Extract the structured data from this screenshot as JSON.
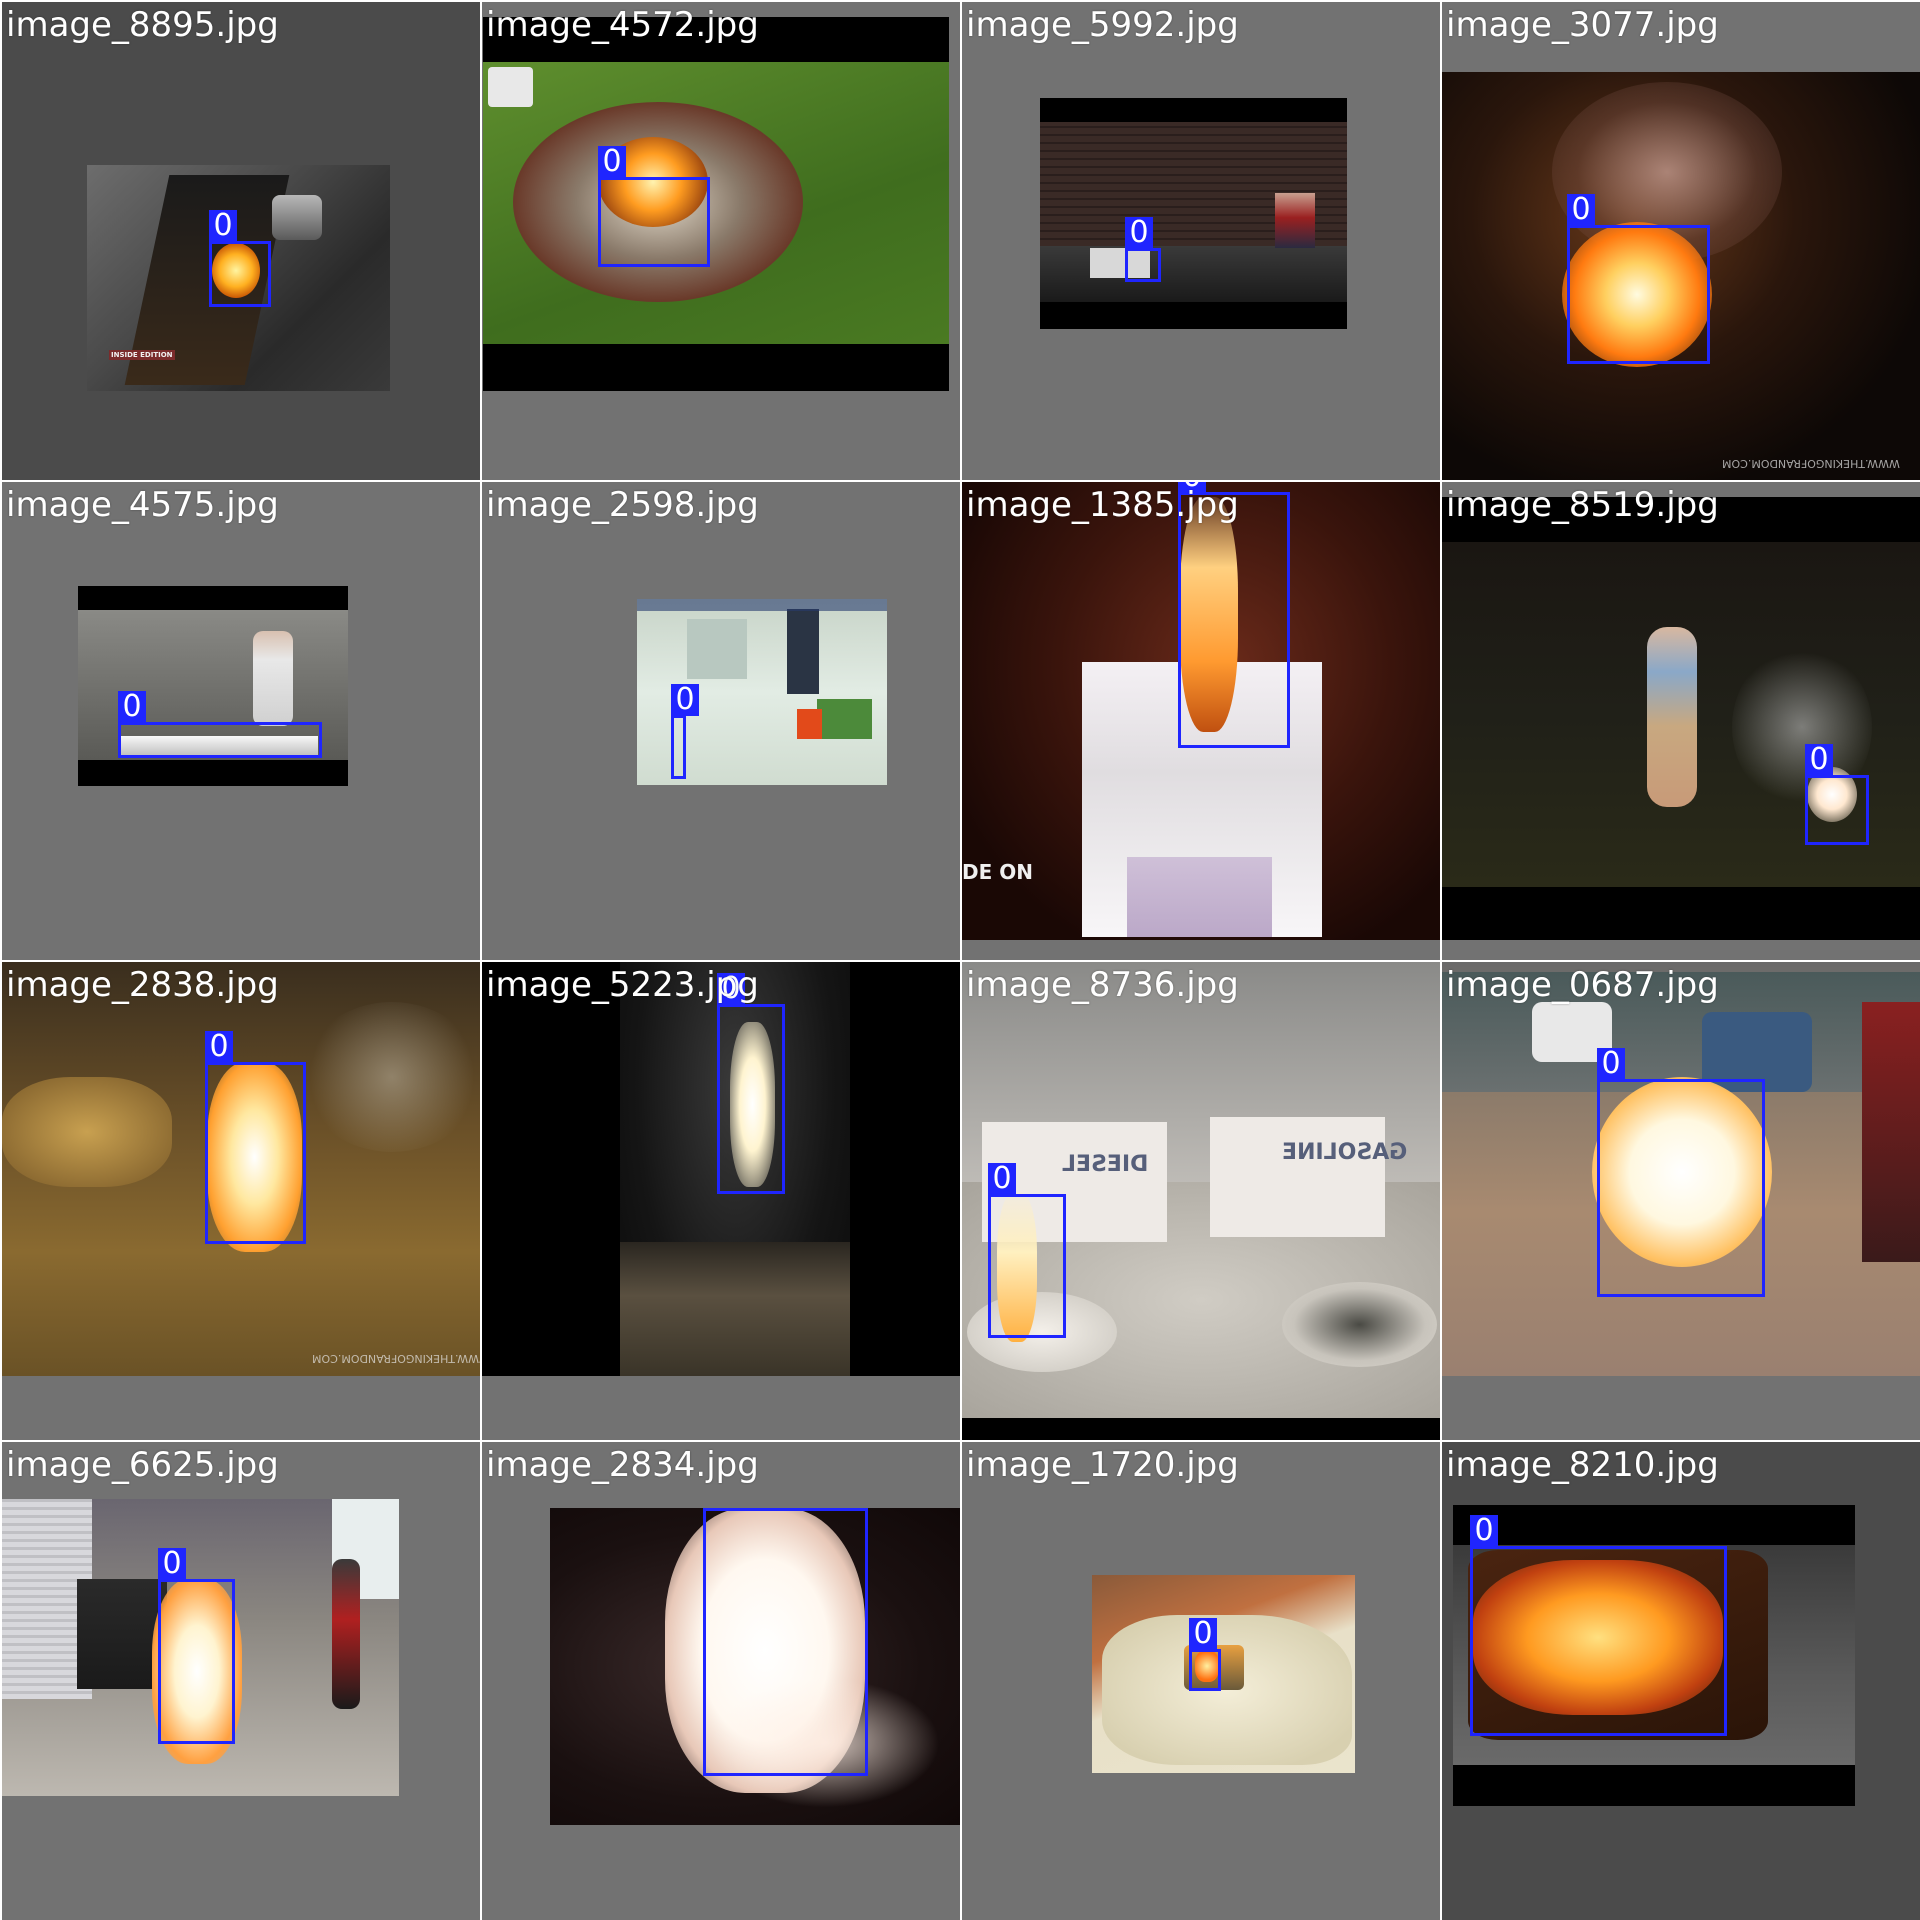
{
  "colors": {
    "box": "#1f25ff",
    "tile_bg": "#727272",
    "tile_bg_dark": "#4b4b4b"
  },
  "tiles": [
    {
      "filename": "image_8895.jpg",
      "class_label": "0",
      "overlay_text": "INSIDE EDITION"
    },
    {
      "filename": "image_4572.jpg",
      "class_label": "0"
    },
    {
      "filename": "image_5992.jpg",
      "class_label": "0"
    },
    {
      "filename": "image_3077.jpg",
      "class_label": "0",
      "overlay_text": "WWW.THEKINGOFRANDOM.COM"
    },
    {
      "filename": "image_4575.jpg",
      "class_label": "0"
    },
    {
      "filename": "image_2598.jpg",
      "class_label": "0"
    },
    {
      "filename": "image_1385.jpg",
      "class_label": "0",
      "overlay_text": "DE ON"
    },
    {
      "filename": "image_8519.jpg",
      "class_label": "0"
    },
    {
      "filename": "image_2838.jpg",
      "class_label": "0",
      "overlay_text": "WWW.THEKINGOFRANDOM.COM"
    },
    {
      "filename": "image_5223.jpg",
      "class_label": "0"
    },
    {
      "filename": "image_8736.jpg",
      "class_label": "0",
      "sign_labels": [
        "DIESEL",
        "GASOLINE"
      ]
    },
    {
      "filename": "image_0687.jpg",
      "class_label": "0"
    },
    {
      "filename": "image_6625.jpg",
      "class_label": "0"
    },
    {
      "filename": "image_2834.jpg",
      "class_label": "0"
    },
    {
      "filename": "image_1720.jpg",
      "class_label": "0"
    },
    {
      "filename": "image_8210.jpg",
      "class_label": "0"
    }
  ]
}
